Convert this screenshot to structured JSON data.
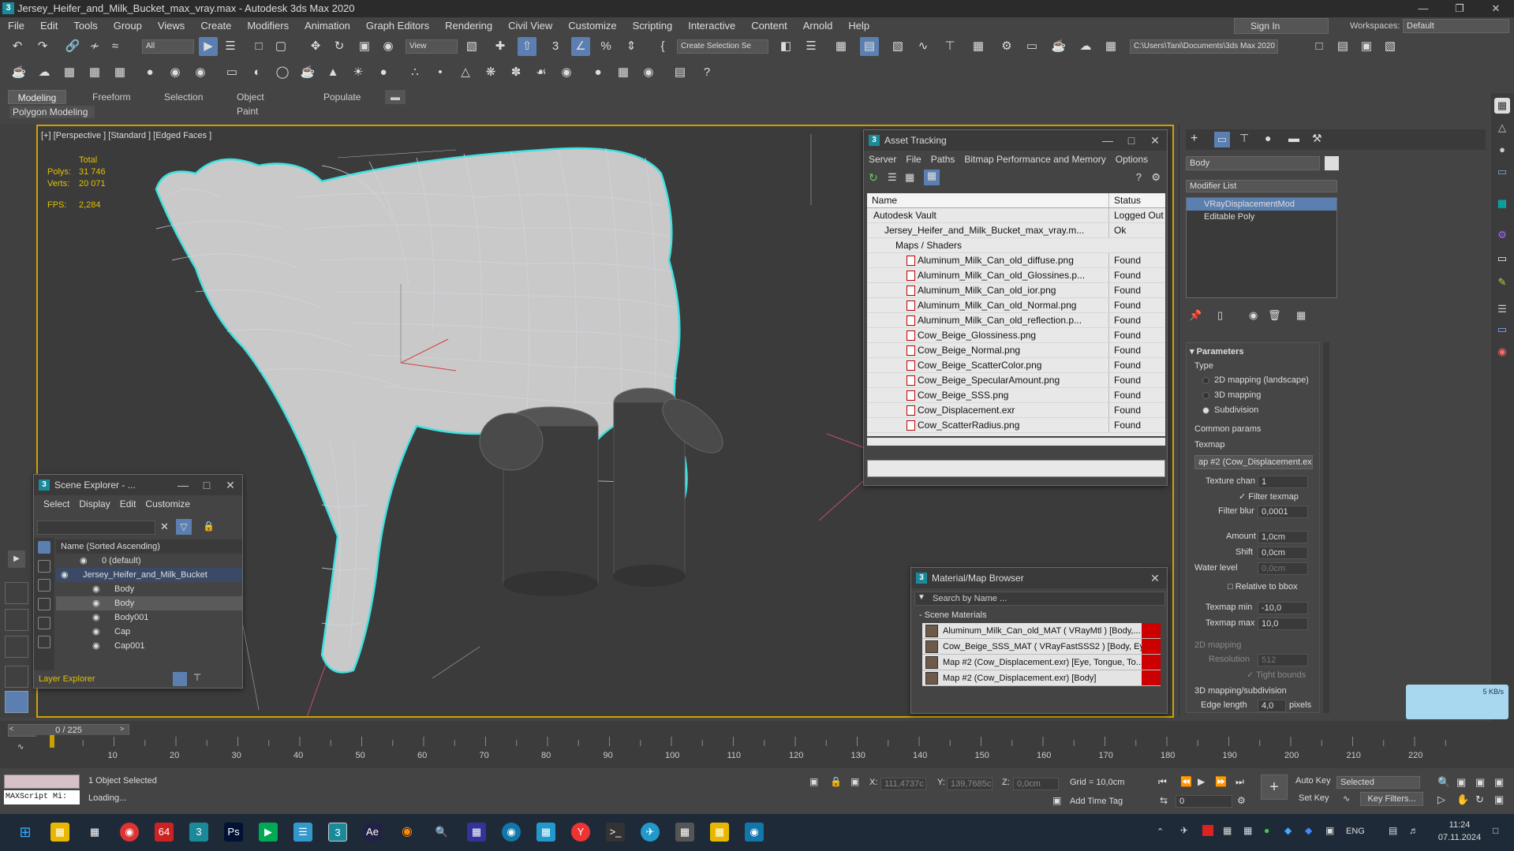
{
  "title_bar": {
    "app_icon": "3",
    "title": "Jersey_Heifer_and_Milk_Bucket_max_vray.max - Autodesk 3ds Max 2020"
  },
  "menu": [
    "File",
    "Edit",
    "Tools",
    "Group",
    "Views",
    "Create",
    "Modifiers",
    "Animation",
    "Graph Editors",
    "Rendering",
    "Civil View",
    "Customize",
    "Scripting",
    "Interactive",
    "Content",
    "Arnold",
    "Help"
  ],
  "signin": "Sign In",
  "workspaces": {
    "label": "Workspaces:",
    "value": "Default"
  },
  "toolbar": {
    "selection_filter": "All",
    "ref_coord": "View",
    "named_selection": "Create Selection Se",
    "project_path": "C:\\Users\\Tani\\Documents\\3ds Max 2020"
  },
  "ribbon": {
    "tabs": [
      "Modeling",
      "Freeform",
      "Selection",
      "Object Paint",
      "Populate"
    ],
    "subpanel": "Polygon Modeling"
  },
  "viewport": {
    "label": "[+] [Perspective ] [Standard ] [Edged Faces ]",
    "stats": {
      "total_label": "Total",
      "polys_label": "Polys:",
      "polys": "31 746",
      "verts_label": "Verts:",
      "verts": "20 071",
      "fps_label": "FPS:",
      "fps": "2,284"
    }
  },
  "asset_tracking": {
    "title": "Asset Tracking",
    "menu": [
      "Server",
      "File",
      "Paths",
      "Bitmap Performance and Memory",
      "Options"
    ],
    "columns": [
      "Name",
      "Status"
    ],
    "rows": [
      {
        "name": "Autodesk Vault",
        "status": "Logged Out ...",
        "indent": 0
      },
      {
        "name": "Jersey_Heifer_and_Milk_Bucket_max_vray.m...",
        "status": "Ok",
        "indent": 1
      },
      {
        "name": "Maps / Shaders",
        "status": "",
        "indent": 2
      },
      {
        "name": "Aluminum_Milk_Can_old_diffuse.png",
        "status": "Found",
        "indent": 3
      },
      {
        "name": "Aluminum_Milk_Can_old_Glossines.p...",
        "status": "Found",
        "indent": 3
      },
      {
        "name": "Aluminum_Milk_Can_old_ior.png",
        "status": "Found",
        "indent": 3
      },
      {
        "name": "Aluminum_Milk_Can_old_Normal.png",
        "status": "Found",
        "indent": 3
      },
      {
        "name": "Aluminum_Milk_Can_old_reflection.p...",
        "status": "Found",
        "indent": 3
      },
      {
        "name": "Cow_Beige_Glossiness.png",
        "status": "Found",
        "indent": 3
      },
      {
        "name": "Cow_Beige_Normal.png",
        "status": "Found",
        "indent": 3
      },
      {
        "name": "Cow_Beige_ScatterColor.png",
        "status": "Found",
        "indent": 3
      },
      {
        "name": "Cow_Beige_SpecularAmount.png",
        "status": "Found",
        "indent": 3
      },
      {
        "name": "Cow_Beige_SSS.png",
        "status": "Found",
        "indent": 3
      },
      {
        "name": "Cow_Displacement.exr",
        "status": "Found",
        "indent": 3
      },
      {
        "name": "Cow_ScatterRadius.png",
        "status": "Found",
        "indent": 3
      }
    ]
  },
  "scene_explorer": {
    "title": "Scene Explorer - ...",
    "menu": [
      "Select",
      "Display",
      "Edit",
      "Customize"
    ],
    "column": "Name (Sorted Ascending)",
    "rows": [
      {
        "name": "0 (default)",
        "selected": false
      },
      {
        "name": "Jersey_Heifer_and_Milk_Bucket",
        "selected": true
      },
      {
        "name": "Body",
        "selected": false
      },
      {
        "name": "Body",
        "selected": true
      },
      {
        "name": "Body001",
        "selected": false
      },
      {
        "name": "Cap",
        "selected": false
      },
      {
        "name": "Cap001",
        "selected": false
      }
    ],
    "footer": "Layer Explorer"
  },
  "material_browser": {
    "title": "Material/Map Browser",
    "search_placeholder": "Search by Name ...",
    "section": "- Scene Materials",
    "rows": [
      "Aluminum_Milk_Can_old_MAT  ( VRayMtl )  [Body,...",
      "Cow_Beige_SSS_MAT  ( VRayFastSSS2 )  [Body, Ey...",
      "Map #2 (Cow_Displacement.exr)  [Eye, Tongue, To...",
      "Map #2 (Cow_Displacement.exr)  [Body]"
    ]
  },
  "command_panel": {
    "object_name": "Body",
    "modifier_list": "Modifier List",
    "stack": [
      "VRayDisplacementMod",
      "Editable Poly"
    ],
    "rollout": "Parameters",
    "type_label": "Type",
    "types": [
      {
        "label": "2D mapping (landscape)",
        "on": false
      },
      {
        "label": "3D mapping",
        "on": false
      },
      {
        "label": "Subdivision",
        "on": true
      }
    ],
    "common_params": "Common params",
    "texmap_label": "Texmap",
    "texmap_value": "ap #2 (Cow_Displacement.ex",
    "texture_chan_label": "Texture chan",
    "texture_chan": "1",
    "filter_texmap": "Filter texmap",
    "filter_blur_label": "Filter blur",
    "filter_blur": "0,0001",
    "amount_label": "Amount",
    "amount": "1,0cm",
    "shift_label": "Shift",
    "shift": "0,0cm",
    "water_label": "Water level",
    "water": "0,0cm",
    "relative": "Relative to bbox",
    "texmap_min_label": "Texmap min",
    "texmap_min": "-10,0",
    "texmap_max_label": "Texmap max",
    "texmap_max": "10,0",
    "mapping2d": "2D mapping",
    "resolution_label": "Resolution",
    "resolution": "512",
    "tight_bounds": "Tight bounds",
    "mapping3d": "3D mapping/subdivision",
    "edge_length_label": "Edge length",
    "edge_length": "4,0",
    "pixels": "pixels"
  },
  "timeline": {
    "frame_counter": "0 / 225",
    "ticks": [
      "10",
      "20",
      "30",
      "40",
      "50",
      "60",
      "70",
      "80",
      "90",
      "100",
      "110",
      "120",
      "130",
      "140",
      "150",
      "160",
      "170",
      "180",
      "190",
      "200",
      "210",
      "220"
    ]
  },
  "status": {
    "maxscript": "MAXScript Mi:",
    "selected": "1 Object Selected",
    "loading": "Loading...",
    "x_label": "X:",
    "x": "111,4737c",
    "y_label": "Y:",
    "y": "139,7685c",
    "z_label": "Z:",
    "z": "0,0cm",
    "grid": "Grid = 10,0cm",
    "add_time_tag": "Add Time Tag",
    "auto_key": "Auto Key",
    "set_key": "Set Key",
    "key_mode": "Selected",
    "key_filters": "Key Filters...",
    "frame": "0"
  },
  "net_widget": "5 KB/s",
  "taskbar": {
    "lang": "ENG",
    "time": "11:24",
    "date": "07.11.2024",
    "badge": "64"
  },
  "colors": {
    "accent": "#5a7fb0",
    "viewport_border": "#d0a000",
    "stats": "#e0c000",
    "select_wire": "#40e0e0"
  }
}
